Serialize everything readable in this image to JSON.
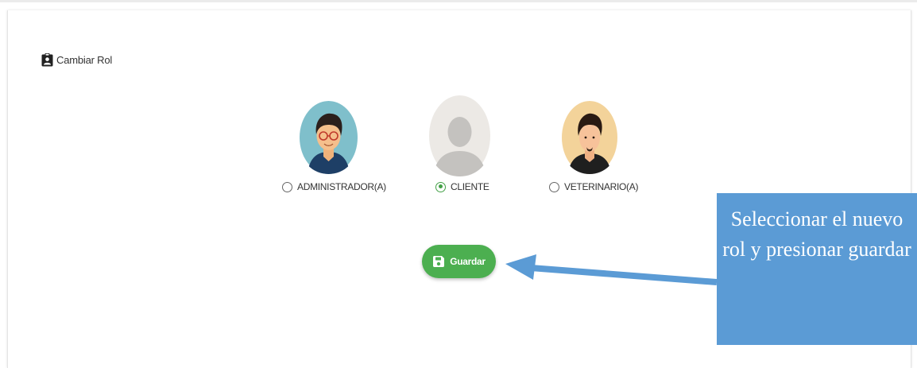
{
  "card": {
    "title": "Cambiar Rol",
    "title_icon": "clipboard-user-icon"
  },
  "roles": [
    {
      "label": "ADMINISTRADOR(A)",
      "selected": false,
      "avatar": "admin-avatar"
    },
    {
      "label": "CLIENTE",
      "selected": true,
      "avatar": "default-user-avatar"
    },
    {
      "label": "VETERINARIO(A)",
      "selected": false,
      "avatar": "vet-avatar"
    }
  ],
  "save_button": {
    "label": "Guardar",
    "icon": "floppy-disk-icon",
    "color": "#4caf50"
  },
  "annotation": {
    "text": "Seleccionar el nuevo rol y presionar guardar",
    "color": "#5b9bd5"
  }
}
